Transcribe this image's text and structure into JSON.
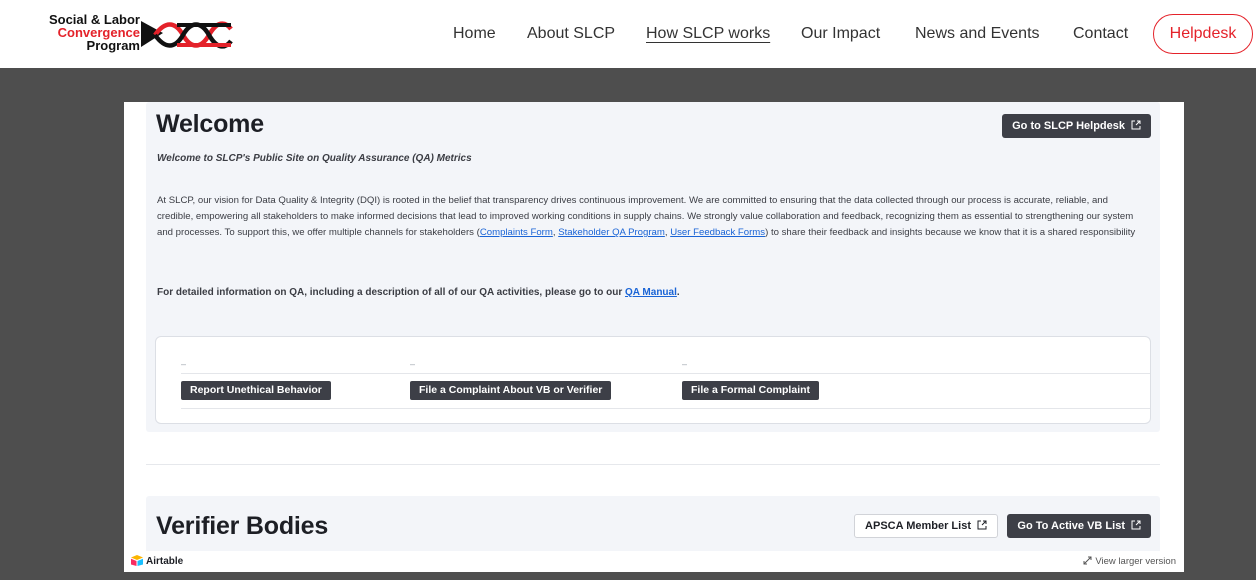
{
  "header": {
    "logo": {
      "line1": "Social & Labor",
      "line2": "Convergence",
      "line3": "Program",
      "colors": {
        "brand_red": "#e4222a",
        "ink": "#111111"
      }
    },
    "nav": [
      {
        "label": "Home",
        "active": false
      },
      {
        "label": "About SLCP",
        "active": false
      },
      {
        "label": "How SLCP works",
        "active": true
      },
      {
        "label": "Our Impact",
        "active": false
      },
      {
        "label": "News and Events",
        "active": false
      },
      {
        "label": "Contact",
        "active": false
      }
    ],
    "helpdesk_label": "Helpdesk"
  },
  "welcome": {
    "title": "Welcome",
    "helpdesk_button": "Go to SLCP Helpdesk",
    "subtitle": "Welcome to SLCP's Public Site on Quality Assurance (QA) Metrics",
    "para_before_links": "At SLCP, our vision for Data Quality & Integrity (DQI) is rooted in the belief that transparency drives continuous improvement. We are committed to ensuring that the data collected through our process is accurate, reliable, and credible, empowering all stakeholders to make informed decisions that lead to improved working conditions in supply chains. We strongly value collaboration and feedback, recognizing them as essential to strengthening our system and processes. To support this, we offer multiple channels for stakeholders (",
    "link_complaints": "Complaints Form",
    "sep1": ", ",
    "link_stakeholder": "Stakeholder QA Program",
    "sep2": ", ",
    "link_feedback": "User Feedback Forms",
    "para_after_links": ") to share their feedback and insights because we know that it is a shared responsibility",
    "qa_prefix": "For detailed information on QA, including a description of all of our QA activities, please go to our ",
    "qa_link": "QA Manual",
    "qa_suffix": ".",
    "action_buttons": [
      {
        "label": "Report Unethical Behavior",
        "dash": "–"
      },
      {
        "label": "File a Complaint About VB or Verifier",
        "dash": "–"
      },
      {
        "label": "File a Formal Complaint",
        "dash": "–"
      }
    ]
  },
  "verifier_bodies": {
    "title": "Verifier Bodies",
    "apsca_button": "APSCA Member List",
    "active_vb_button": "Go To Active VB List"
  },
  "embed_footer": {
    "brand": "Airtable",
    "view_larger": "View larger version"
  },
  "colors": {
    "page_backdrop": "#4e4e4e",
    "section_bg": "#f3f5f9",
    "dark_button": "#3d3f47",
    "link": "#1a64d6"
  }
}
